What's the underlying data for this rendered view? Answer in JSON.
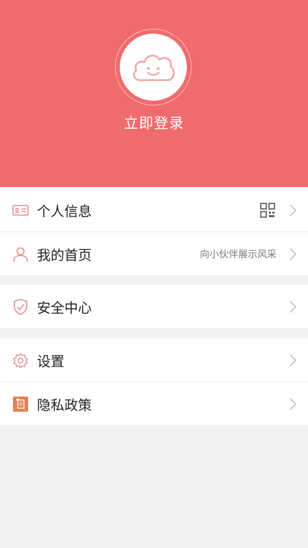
{
  "header": {
    "login_label": "立即登录",
    "background_color": "#f06b6d",
    "avatar_icon": "smiling-cloud-icon"
  },
  "menu": {
    "group1": [
      {
        "label": "个人信息",
        "icon": "id-card-icon",
        "extra_icon": "qr-code-icon"
      },
      {
        "label": "我的首页",
        "icon": "user-icon",
        "extra_text": "向小伙伴展示风采"
      }
    ],
    "group2": [
      {
        "label": "安全中心",
        "icon": "shield-check-icon"
      }
    ],
    "group3": [
      {
        "label": "设置",
        "icon": "gear-icon"
      },
      {
        "label": "隐私政策",
        "icon": "document-icon"
      }
    ]
  },
  "colors": {
    "accent": "#f06b6d",
    "background": "#f2f1f4",
    "chevron": "#c8c8c8"
  }
}
